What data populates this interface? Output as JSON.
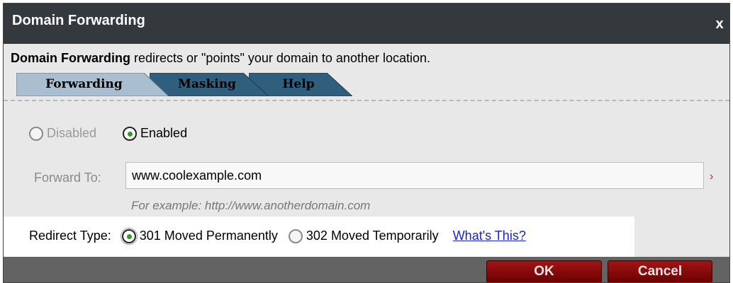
{
  "dialog": {
    "title": "Domain Forwarding",
    "close_label": "x"
  },
  "description": {
    "bold": "Domain Forwarding",
    "rest": " redirects or \"points\" your domain to another location."
  },
  "tabs": [
    {
      "label": "Forwarding",
      "active": true
    },
    {
      "label": "Masking",
      "active": false
    },
    {
      "label": "Help",
      "active": false
    }
  ],
  "status_options": [
    {
      "label": "Disabled",
      "checked": false
    },
    {
      "label": "Enabled",
      "checked": true
    }
  ],
  "forward_to": {
    "label": "Forward To:",
    "value": "www.coolexample.com",
    "required_mark": "›",
    "hint": "For example: http://www.anotherdomain.com"
  },
  "redirect": {
    "label": "Redirect Type:",
    "options": [
      {
        "label": "301 Moved Permanently",
        "checked": true
      },
      {
        "label": "302 Moved Temporarily",
        "checked": false
      }
    ],
    "help_link": "What's This?"
  },
  "buttons": {
    "ok": "OK",
    "cancel": "Cancel"
  },
  "colors": {
    "titlebar": "#34393e",
    "tab_active": "#a9bfcf",
    "tab_inactive": "#2f5f7d",
    "button": "#8b0b0b",
    "link": "#1a24c6"
  }
}
